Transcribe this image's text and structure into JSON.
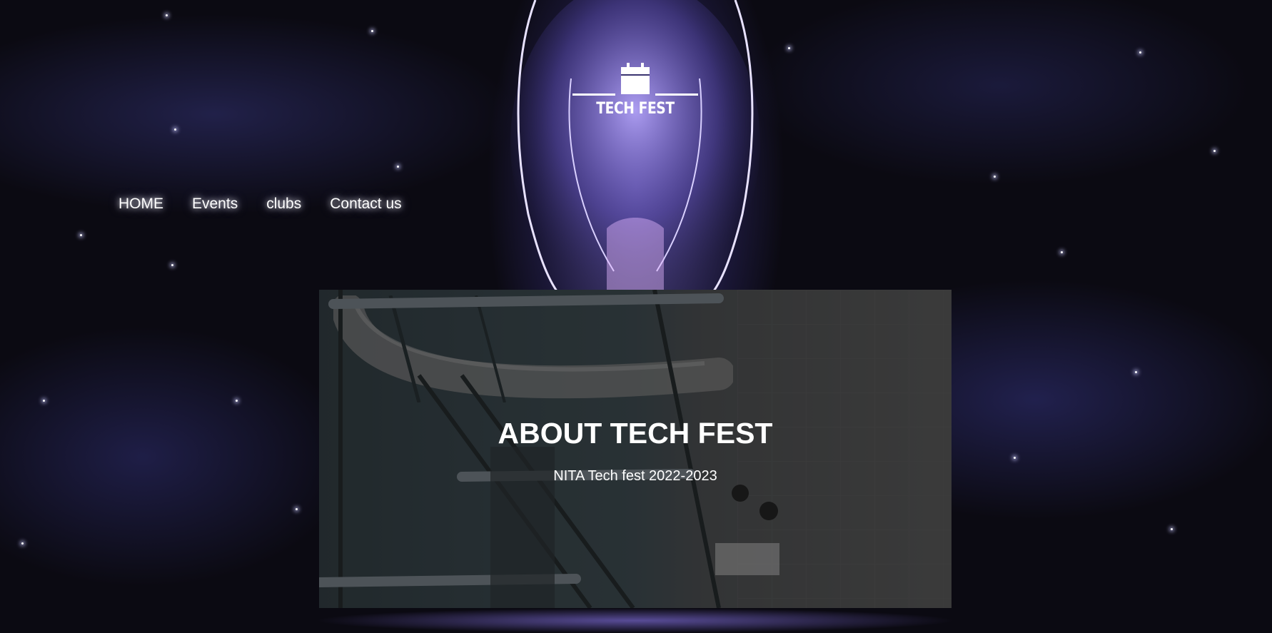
{
  "logo": {
    "text": "TECH FEST",
    "icon": "calendar-icon"
  },
  "nav": {
    "items": [
      {
        "label": "HOME"
      },
      {
        "label": "Events"
      },
      {
        "label": "clubs"
      },
      {
        "label": "Contact us"
      }
    ]
  },
  "hero": {
    "title": "ABOUT TECH FEST",
    "subtitle": "NITA Tech fest 2022-2023"
  },
  "colors": {
    "background": "#0b0a12",
    "glow": "#9682ff",
    "text": "#ffffff"
  }
}
